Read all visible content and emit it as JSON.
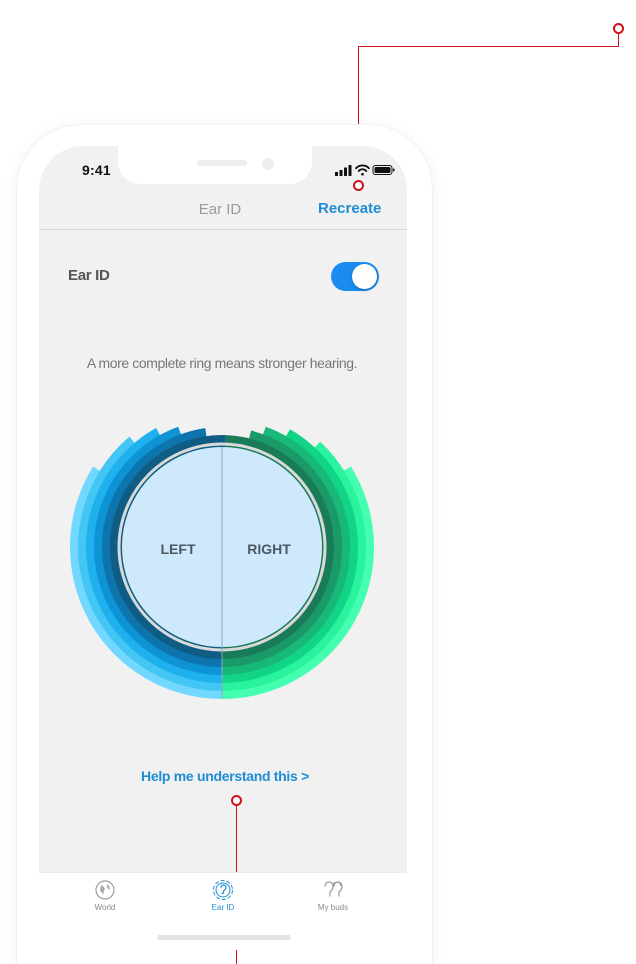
{
  "status_bar": {
    "time": "9:41"
  },
  "nav": {
    "title": "Ear ID",
    "action_label": "Recreate"
  },
  "setting": {
    "label": "Ear ID",
    "toggle_on": true
  },
  "subtitle": "A more complete ring means stronger hearing.",
  "chart": {
    "left_label": "LEFT",
    "right_label": "RIGHT"
  },
  "help_link": "Help me understand this >",
  "tabs": [
    {
      "label": "World",
      "icon": "globe-icon",
      "active": false
    },
    {
      "label": "Ear ID",
      "icon": "ear-icon",
      "active": true
    },
    {
      "label": "My buds",
      "icon": "earbuds-icon",
      "active": false
    }
  ],
  "colors": {
    "accent": "#1f8dd6",
    "toggle": "#1a8cf0",
    "callout": "#d0101a",
    "inner_circle": "#cde9fb",
    "left_rings": [
      "#72d8ff",
      "#44c6f5",
      "#1fb0ee",
      "#0e93d4",
      "#0d74ad",
      "#0f5d84"
    ],
    "right_rings": [
      "#43ffaf",
      "#29f39c",
      "#12d487",
      "#17b878",
      "#1a9a68",
      "#1a7b58"
    ]
  }
}
